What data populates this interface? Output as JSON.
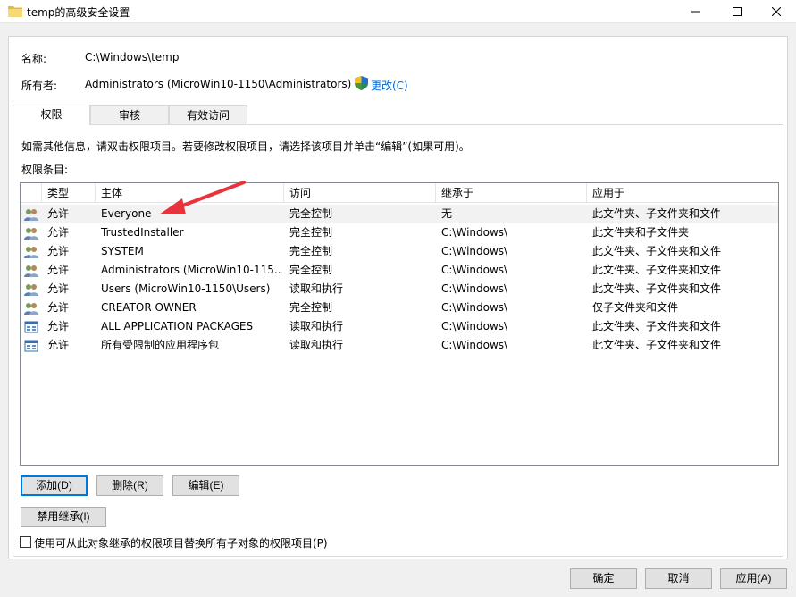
{
  "window": {
    "title": "temp的高级安全设置"
  },
  "name_label": "名称:",
  "name_value": "C:\\Windows\\temp",
  "owner_label": "所有者:",
  "owner_value": "Administrators (MicroWin10-1150\\Administrators)",
  "owner_change_link": "更改(C)",
  "tabs": [
    {
      "label": "权限"
    },
    {
      "label": "审核"
    },
    {
      "label": "有效访问"
    }
  ],
  "info_text": "如需其他信息，请双击权限项目。若要修改权限项目，请选择该项目并单击“编辑”(如果可用)。",
  "entries_label": "权限条目:",
  "columns": [
    "类型",
    "主体",
    "访问",
    "继承于",
    "应用于"
  ],
  "rows": [
    {
      "icon": "users-icon",
      "type": "允许",
      "principal": "Everyone",
      "access": "完全控制",
      "inherited": "无",
      "applies": "此文件夹、子文件夹和文件"
    },
    {
      "icon": "users-icon",
      "type": "允许",
      "principal": "TrustedInstaller",
      "access": "完全控制",
      "inherited": "C:\\Windows\\",
      "applies": "此文件夹和子文件夹"
    },
    {
      "icon": "users-icon",
      "type": "允许",
      "principal": "SYSTEM",
      "access": "完全控制",
      "inherited": "C:\\Windows\\",
      "applies": "此文件夹、子文件夹和文件"
    },
    {
      "icon": "users-icon",
      "type": "允许",
      "principal": "Administrators (MicroWin10-115...",
      "access": "完全控制",
      "inherited": "C:\\Windows\\",
      "applies": "此文件夹、子文件夹和文件"
    },
    {
      "icon": "users-icon",
      "type": "允许",
      "principal": "Users (MicroWin10-1150\\Users)",
      "access": "读取和执行",
      "inherited": "C:\\Windows\\",
      "applies": "此文件夹、子文件夹和文件"
    },
    {
      "icon": "users-icon",
      "type": "允许",
      "principal": "CREATOR OWNER",
      "access": "完全控制",
      "inherited": "C:\\Windows\\",
      "applies": "仅子文件夹和文件"
    },
    {
      "icon": "package-icon",
      "type": "允许",
      "principal": "ALL APPLICATION PACKAGES",
      "access": "读取和执行",
      "inherited": "C:\\Windows\\",
      "applies": "此文件夹、子文件夹和文件"
    },
    {
      "icon": "package-icon",
      "type": "允许",
      "principal": "所有受限制的应用程序包",
      "access": "读取和执行",
      "inherited": "C:\\Windows\\",
      "applies": "此文件夹、子文件夹和文件"
    }
  ],
  "buttons": {
    "add": "添加(D)",
    "remove": "删除(R)",
    "edit": "编辑(E)",
    "disable_inheritance": "禁用继承(I)",
    "ok": "确定",
    "cancel": "取消",
    "apply": "应用(A)"
  },
  "replace_checkbox_label": "使用可从此对象继承的权限项目替换所有子对象的权限项目(P)",
  "replace_checkbox_checked": false,
  "annotation": {
    "arrow_color": "#e8333a"
  }
}
